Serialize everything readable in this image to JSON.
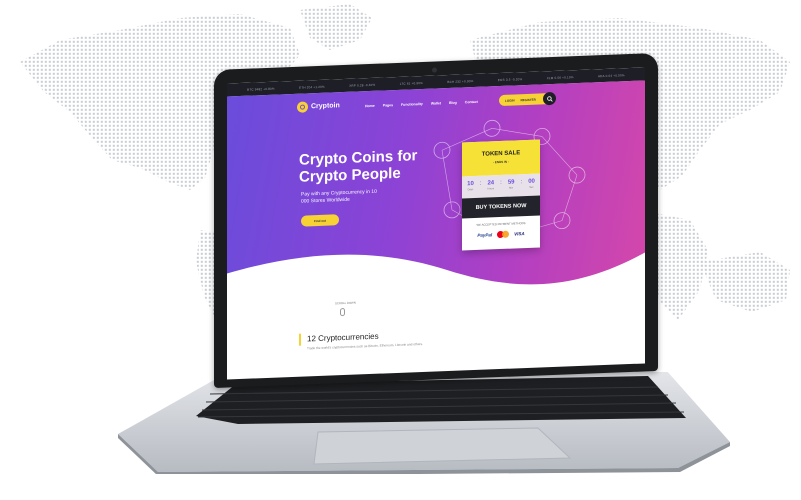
{
  "topbar": {
    "items": [
      "BTC 9482 +0.80%",
      "ETH 204 +1.20%",
      "XRP 0.28 -0.40%",
      "LTC 61 +0.90%",
      "BCH 232 +0.30%",
      "EOS 3.5 -0.20%",
      "XLM 0.06 +0.10%",
      "ADA 0.04 +0.50%"
    ]
  },
  "brand": {
    "name": "Cryptoin",
    "small": "Crypto",
    "accent": "#f6d234",
    "hero_gradient": [
      "#6a4cdb",
      "#b23fc2",
      "#d447aa"
    ]
  },
  "nav": {
    "links": [
      "Home",
      "Pages",
      "Functionality",
      "Wallet",
      "Blog",
      "Contact"
    ],
    "login_label": "LOGIN",
    "register_label": "REGISTER",
    "search_icon": "search-icon"
  },
  "hero": {
    "headline": "Crypto Coins for Crypto People",
    "subtext": "Pay with any Cryptocurrency in 10 000 Stores Worldwide",
    "button_label": "Find out"
  },
  "token": {
    "title": "TOKEN SALE",
    "ends_in": "- ENDS IN -",
    "countdown": [
      {
        "value": "10",
        "label": "Days"
      },
      {
        "value": "24",
        "label": "Hours"
      },
      {
        "value": "59",
        "label": "Min"
      },
      {
        "value": "00",
        "label": "Sec"
      }
    ],
    "buy_label": "BUY TOKENS NOW",
    "accepted": "WE ACCEPTED PAYMENT METHODS",
    "payments": [
      "PayPal",
      "VISA"
    ]
  },
  "scroll": {
    "label": "SCROLL DOWN"
  },
  "section": {
    "title": "12 Cryptocurrencies",
    "desc": "Trade the world's cryptocurrencies such as Bitcoin, Ethereum, Litecoin and others."
  }
}
